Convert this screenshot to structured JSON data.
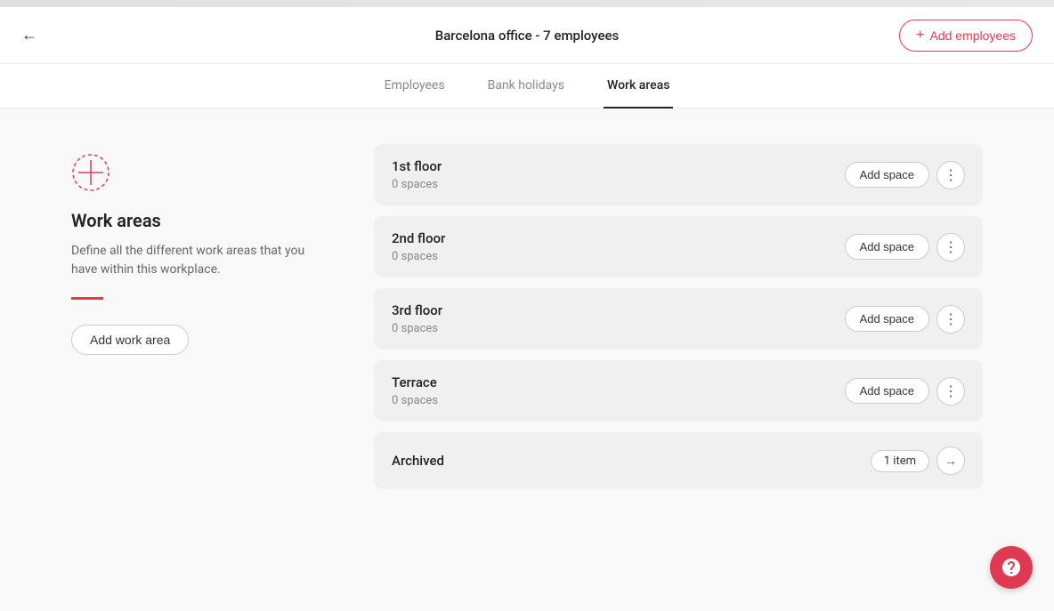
{
  "topbar": {},
  "header": {
    "title": "Barcelona office - 7 employees",
    "add_employees_label": "Add employees",
    "plus_icon": "+"
  },
  "tabs": [
    {
      "label": "Employees",
      "active": false
    },
    {
      "label": "Bank holidays",
      "active": false
    },
    {
      "label": "Work areas",
      "active": true
    }
  ],
  "left_panel": {
    "section_title": "Work areas",
    "section_desc": "Define all the different work areas that you have within this workplace.",
    "add_work_area_label": "Add work area"
  },
  "work_areas": [
    {
      "name": "1st floor",
      "spaces": "0 spaces"
    },
    {
      "name": "2nd floor",
      "spaces": "0 spaces"
    },
    {
      "name": "3rd floor",
      "spaces": "0 spaces"
    },
    {
      "name": "Terrace",
      "spaces": "0 spaces"
    }
  ],
  "archived": {
    "label": "Archived",
    "badge": "1 item"
  },
  "buttons": {
    "add_space": "Add space",
    "back_icon": "←"
  }
}
